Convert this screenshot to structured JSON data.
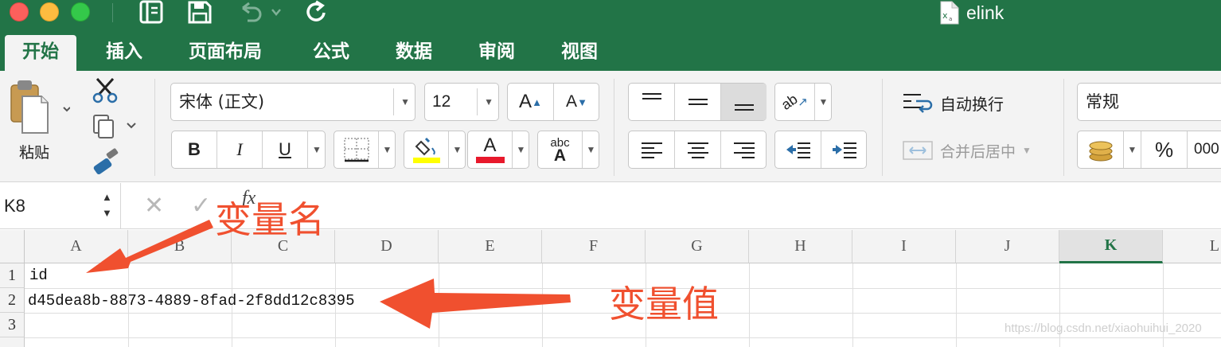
{
  "window": {
    "title": "elink",
    "file_icon": "excel-file-icon"
  },
  "quick_access": [
    "sidebar-icon",
    "save-icon",
    "undo-icon",
    "redo-icon"
  ],
  "tabs": [
    {
      "label": "开始",
      "active": true
    },
    {
      "label": "插入",
      "active": false
    },
    {
      "label": "页面布局",
      "active": false
    },
    {
      "label": "公式",
      "active": false
    },
    {
      "label": "数据",
      "active": false
    },
    {
      "label": "审阅",
      "active": false
    },
    {
      "label": "视图",
      "active": false
    }
  ],
  "ribbon": {
    "paste_label": "粘贴",
    "font_name": "宋体 (正文)",
    "font_size": "12",
    "increase_font": "A",
    "decrease_font": "A",
    "bold": "B",
    "italic": "I",
    "underline": "U",
    "font_color_letter": "A",
    "font_color": "#e8192c",
    "fill_color": "#ffff00",
    "phonetic_label": "abc",
    "phonetic_letter": "A",
    "orientation_label": "ab",
    "wrap_text": "自动换行",
    "merge_center": "合并后居中",
    "number_format": "常规",
    "percent": "%",
    "comma": "000"
  },
  "formula_bar": {
    "name_box": "K8",
    "fx": "fx",
    "formula": ""
  },
  "sheet": {
    "columns": [
      "A",
      "B",
      "C",
      "D",
      "E",
      "F",
      "G",
      "H",
      "I",
      "J",
      "K",
      "L"
    ],
    "selected_column": "K",
    "rows": [
      "1",
      "2",
      "3"
    ],
    "cells": {
      "A1": "id",
      "A2": "d45dea8b-8873-4889-8fad-2f8dd12c8395"
    }
  },
  "annotations": {
    "variable_name": "变量名",
    "variable_value": "变量值",
    "color": "#f0502f"
  },
  "watermark": "https://blog.csdn.net/xiaohuihui_2020"
}
